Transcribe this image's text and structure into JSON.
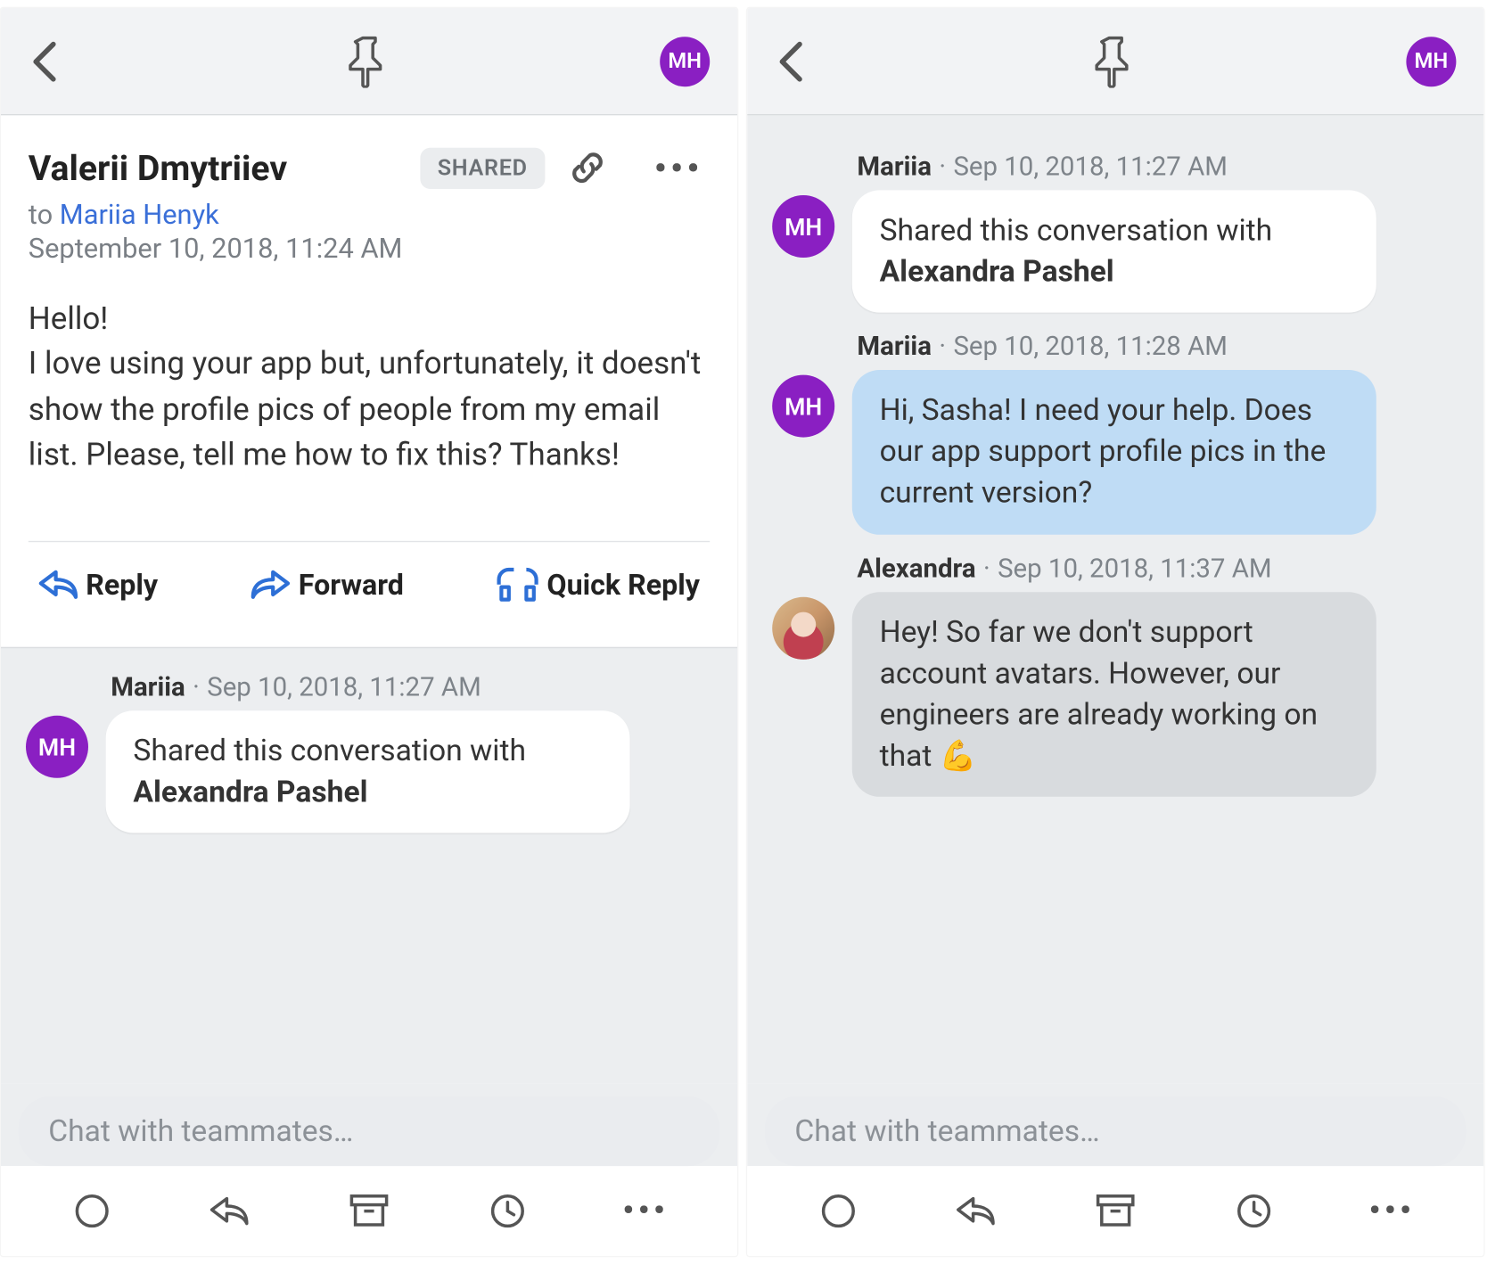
{
  "topbar": {
    "avatar_initials": "MH"
  },
  "email": {
    "sender": "Valerii Dmytriiev",
    "shared_badge": "SHARED",
    "to_prefix": "to ",
    "recipient": "Mariia Henyk",
    "date": "September 10, 2018, 11:24 AM",
    "body": "Hello!\nI love using your app but, unfortunately, it doesn't show the profile pics of people from my email list. Please, tell me how to fix this? Thanks!",
    "actions": {
      "reply": "Reply",
      "forward": "Forward",
      "quick_reply": "Quick Reply"
    }
  },
  "left_chat": {
    "msg1": {
      "author": "Mariia",
      "time": "Sep 10, 2018, 11:27 AM",
      "initials": "MH",
      "text_prefix": "Shared this conversation with ",
      "bold_name": "Alexandra Pashel"
    }
  },
  "right_chat": {
    "msg1": {
      "author": "Mariia",
      "time": "Sep 10, 2018, 11:27 AM",
      "initials": "MH",
      "text_prefix": "Shared this conversation with ",
      "bold_name": "Alexandra Pashel"
    },
    "msg2": {
      "author": "Mariia",
      "time": "Sep 10, 2018, 11:28 AM",
      "initials": "MH",
      "text": "Hi, Sasha! I need your help. Does our app support profile pics in the current version?"
    },
    "msg3": {
      "author": "Alexandra",
      "time": "Sep 10, 2018, 11:37 AM",
      "text": "Hey! So far we don't support account avatars. However, our engineers are already working on that 💪"
    }
  },
  "chat_input": {
    "placeholder": "Chat with teammates…"
  }
}
